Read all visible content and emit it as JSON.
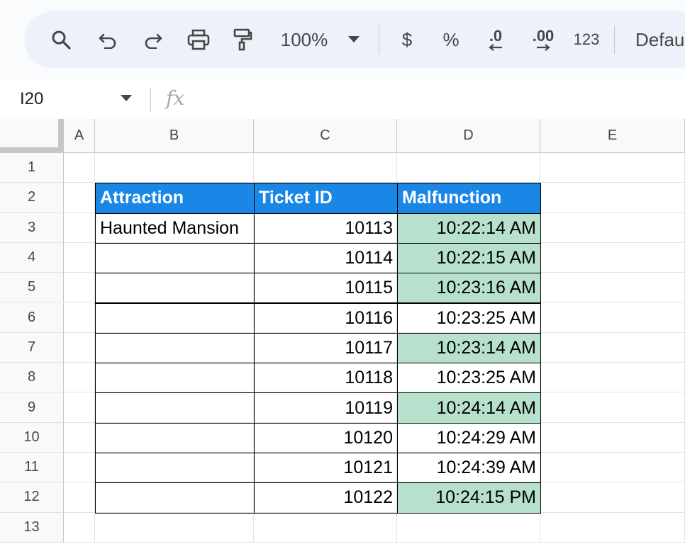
{
  "toolbar": {
    "zoom": "100%",
    "currency": "$",
    "percent": "%",
    "decrease_decimal": ".0",
    "increase_decimal": ".00",
    "number_format": "123",
    "font": "Defau"
  },
  "formula_bar": {
    "name_box": "I20",
    "fx": "fx"
  },
  "columns": [
    "A",
    "B",
    "C",
    "D",
    "E"
  ],
  "rows": [
    "1",
    "2",
    "3",
    "4",
    "5",
    "6",
    "7",
    "8",
    "9",
    "10",
    "11",
    "12",
    "13"
  ],
  "table": {
    "headers": [
      "Attraction",
      "Ticket ID",
      "Malfunction"
    ],
    "rows": [
      {
        "attraction": "Haunted Mansion",
        "ticket": "10113",
        "time": "10:22:14 AM",
        "highlight": true
      },
      {
        "attraction": "",
        "ticket": "10114",
        "time": "10:22:15 AM",
        "highlight": true
      },
      {
        "attraction": "",
        "ticket": "10115",
        "time": "10:23:16 AM",
        "highlight": true
      },
      {
        "attraction": "",
        "ticket": "10116",
        "time": "10:23:25 AM",
        "highlight": false
      },
      {
        "attraction": "",
        "ticket": "10117",
        "time": "10:23:14 AM",
        "highlight": true
      },
      {
        "attraction": "",
        "ticket": "10118",
        "time": "10:23:25 AM",
        "highlight": false
      },
      {
        "attraction": "",
        "ticket": "10119",
        "time": "10:24:14 AM",
        "highlight": true
      },
      {
        "attraction": "",
        "ticket": "10120",
        "time": "10:24:29 AM",
        "highlight": false
      },
      {
        "attraction": "",
        "ticket": "10121",
        "time": "10:24:39 AM",
        "highlight": false
      },
      {
        "attraction": "",
        "ticket": "10122",
        "time": "10:24:15 PM",
        "highlight": true
      }
    ]
  },
  "colors": {
    "header_fill": "#1a87e6",
    "highlight_fill": "#b7e1cd"
  }
}
